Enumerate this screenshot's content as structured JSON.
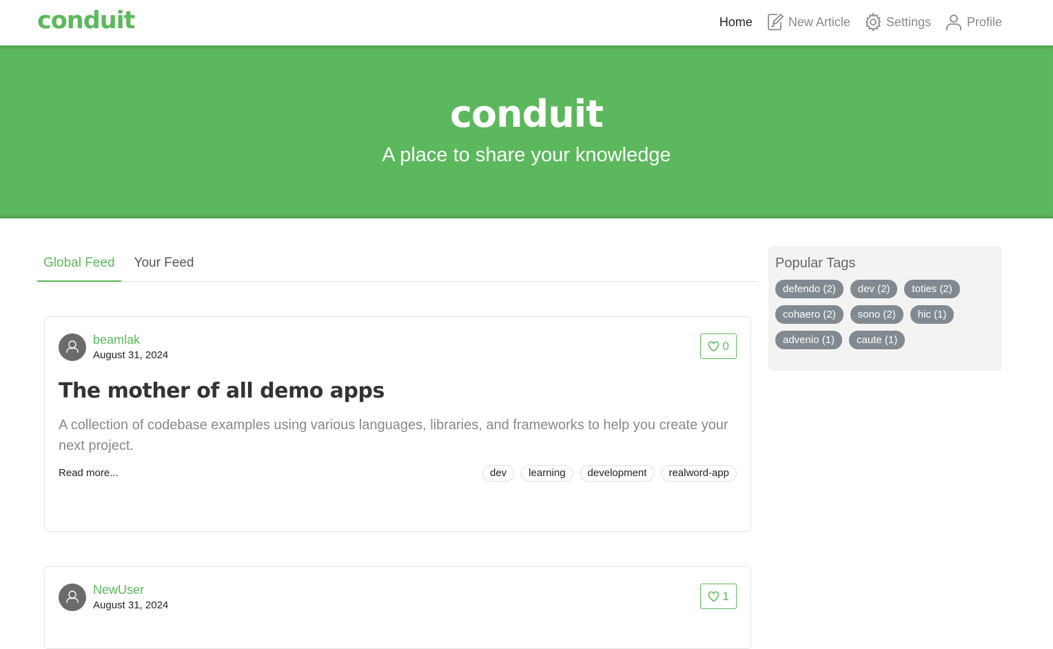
{
  "navbar": {
    "brand": "conduit",
    "items": [
      {
        "label": "Home",
        "icon": "none",
        "active": true
      },
      {
        "label": "New Article",
        "icon": "edit-icon",
        "active": false
      },
      {
        "label": "Settings",
        "icon": "gear-icon",
        "active": false
      },
      {
        "label": "Profile",
        "icon": "user-icon",
        "active": false
      }
    ]
  },
  "banner": {
    "title": "conduit",
    "subtitle": "A place to share your knowledge"
  },
  "feed": {
    "tabs": [
      {
        "label": "Global Feed",
        "active": true
      },
      {
        "label": "Your Feed",
        "active": false
      }
    ],
    "articles": [
      {
        "author": "beamlak",
        "date": "August 31, 2024",
        "likes": "0",
        "title": "The mother of all demo apps",
        "description": "A collection of codebase examples using various languages, libraries, and frameworks to help you create your next project.",
        "read_more": "Read more...",
        "tags": [
          "dev",
          "learning",
          "development",
          "realword-app"
        ]
      },
      {
        "author": "NewUser",
        "date": "August 31, 2024",
        "likes": "1"
      }
    ]
  },
  "sidebar": {
    "title": "Popular Tags",
    "tags": [
      "defendo (2)",
      "dev (2)",
      "toties (2)",
      "cohaero (2)",
      "sono (2)",
      "hic (1)",
      "advenio (1)",
      "caute (1)"
    ]
  },
  "colors": {
    "brand": "#5cb85c",
    "tag_pill": "#818a91"
  }
}
